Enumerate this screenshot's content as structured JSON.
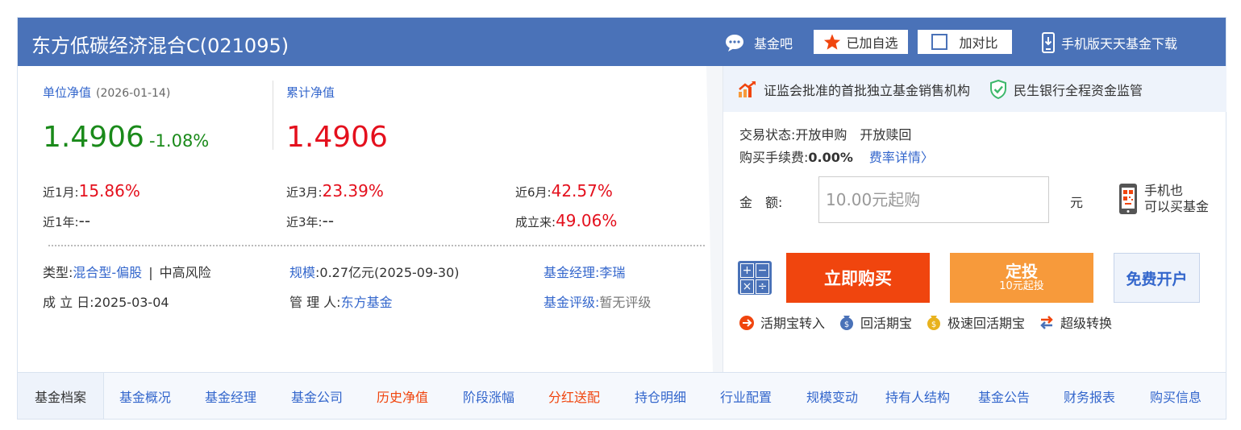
{
  "header": {
    "fund_title": "东方低碳经济混合C(021095)",
    "fund_bar": "基金吧",
    "added_watch": "已加自选",
    "compare": "加对比",
    "mobile_download": "手机版天天基金下载"
  },
  "nav": {
    "unit_label": "单位净值",
    "unit_date": "(2026-01-14)",
    "unit_value": "1.4906",
    "unit_change": "-1.08%",
    "cumulative_label": "累计净值",
    "cumulative_value": "1.4906"
  },
  "performance": [
    {
      "label": "近1月:",
      "value": "15.86%"
    },
    {
      "label": "近3月:",
      "value": "23.39%"
    },
    {
      "label": "近6月:",
      "value": "42.57%"
    },
    {
      "label": "近1年:",
      "value": "--"
    },
    {
      "label": "近3年:",
      "value": "--"
    },
    {
      "label": "成立来:",
      "value": "49.06%"
    }
  ],
  "info": {
    "type_label": "类型:",
    "type_value": "混合型-偏股",
    "risk": "中高风险",
    "scale_label": "规模",
    "scale_value": ":0.27亿元(2025-09-30)",
    "manager_label": "基金经理:",
    "manager_value": "李瑞",
    "inception_label": "成 立 日:",
    "inception_value": "2025-03-04",
    "custodian_label": "管 理 人:",
    "custodian_value": "东方基金",
    "rating_label": "基金评级:",
    "rating_value": "暂无评级"
  },
  "trust": {
    "item1": "证监会批准的首批独立基金销售机构",
    "item2": "民生银行全程资金监管"
  },
  "trade": {
    "status_label": "交易状态:",
    "status_buy": "开放申购",
    "status_redeem": "开放赎回",
    "fee_label": "购买手续费:",
    "fee_value": "0.00%",
    "fee_detail": "费率详情〉",
    "amount_label": "金　额:",
    "amount_placeholder": "10.00元起购",
    "amount_unit": "元",
    "mobile_line1": "手机也",
    "mobile_line2": "可以买基金",
    "buy_now": "立即购买",
    "dingtou": "定投",
    "dingtou_sub": "10元起投",
    "free_open": "免费开户",
    "links": [
      "活期宝转入",
      "回活期宝",
      "极速回活期宝",
      "超级转换"
    ]
  },
  "tabs": {
    "first": "基金档案",
    "items": [
      "基金概况",
      "基金经理",
      "基金公司",
      "历史净值",
      "阶段涨幅",
      "分红送配",
      "持仓明细",
      "行业配置",
      "规模变动",
      "持有人结构",
      "基金公告",
      "财务报表",
      "购买信息"
    ]
  },
  "colors": {
    "header_bg": "#4a72b8",
    "link": "#3366cc",
    "up": "#e4101d",
    "down": "#1a8a1a",
    "buy": "#f0450e",
    "dingtou": "#f79a3b"
  }
}
